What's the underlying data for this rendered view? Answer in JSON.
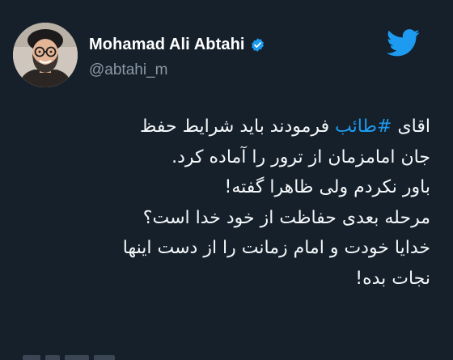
{
  "author": {
    "display_name": "Mohamad Ali Abtahi",
    "handle": "@abtahi_m",
    "verified": true,
    "avatar_icon": "profile-photo"
  },
  "brand": {
    "icon": "twitter-bird-icon",
    "accent_color": "#1d9bf0",
    "background_color": "#15202b"
  },
  "tweet": {
    "line1_before": "اقای ",
    "hashtag": "#طائب",
    "line1_after": " فرمودند باید شرایط حفظ",
    "line2": "جان امامزمان از ترور را آماده کرد.",
    "line3": "باور نکردم ولی ظاهرا گفته!",
    "line4": "مرحله بعدی حفاظت از خود خدا است؟",
    "line5": "خدایا خودت و امام زمانت را از دست اینها",
    "line6": "نجات بده!"
  }
}
